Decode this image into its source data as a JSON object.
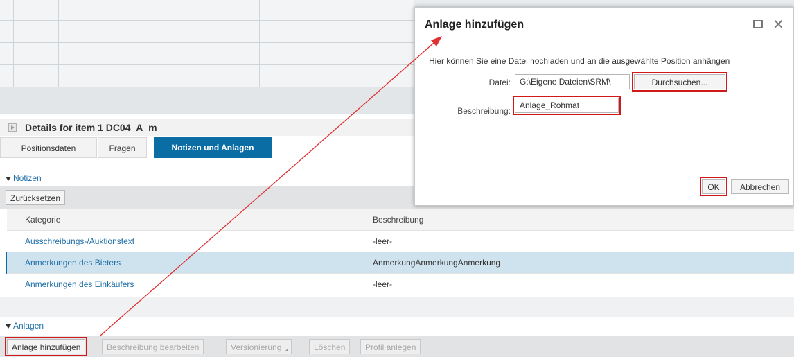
{
  "details": {
    "title": "Details for item 1  DC04_A_m",
    "tabs": [
      {
        "label": "Positionsdaten"
      },
      {
        "label": "Fragen"
      },
      {
        "label": "Notizen und Anlagen"
      }
    ]
  },
  "notes": {
    "section_label": "Notizen",
    "reset_button": "Zurücksetzen",
    "columns": [
      "Kategorie",
      "Beschreibung"
    ],
    "rows": [
      {
        "kategorie": "Ausschreibungs-/Auktionstext",
        "beschreibung": "-leer-"
      },
      {
        "kategorie": "Anmerkungen des Bieters",
        "beschreibung": "AnmerkungAnmerkungAnmerkung"
      },
      {
        "kategorie": "Anmerkungen des Einkäufers",
        "beschreibung": "-leer-"
      }
    ]
  },
  "attachments": {
    "section_label": "Anlagen",
    "buttons": {
      "add": "Anlage hinzufügen",
      "edit_desc": "Beschreibung bearbeiten",
      "versioning": "Versionierung",
      "delete": "Löschen",
      "create_profile": "Profil anlegen"
    }
  },
  "dialog": {
    "title": "Anlage hinzufügen",
    "instruction": "Hier können Sie eine Datei hochladen und an die ausgewählte Position anhängen",
    "file_label": "Datei:",
    "file_value": "G:\\Eigene Dateien\\SRM\\",
    "browse_button": "Durchsuchen...",
    "description_label": "Beschreibung:",
    "description_value": "Anlage_Rohmat",
    "ok_button": "OK",
    "cancel_button": "Abbrechen"
  },
  "colors": {
    "accent": "#0a6ea5",
    "highlight_box": "#d11919",
    "link": "#1f6fa8"
  }
}
